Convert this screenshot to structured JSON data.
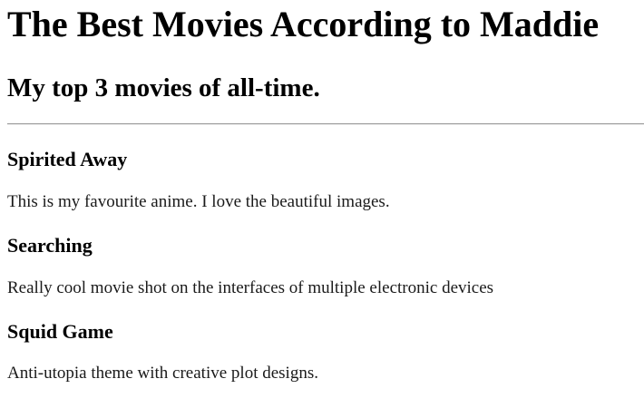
{
  "header": {
    "title": "The Best Movies According to Maddie",
    "subtitle": "My top 3 movies of all-time."
  },
  "movies": [
    {
      "title": "Spirited Away",
      "description": "This is my favourite anime. I love the beautiful images."
    },
    {
      "title": "Searching",
      "description": "Really cool movie shot on the interfaces of multiple electronic devices"
    },
    {
      "title": "Squid Game",
      "description": "Anti-utopia theme with creative plot designs."
    }
  ]
}
